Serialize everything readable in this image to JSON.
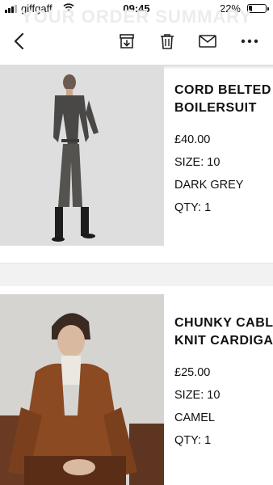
{
  "status_bar": {
    "carrier": "giffgaff",
    "time": "09:45",
    "battery_pct": "22%",
    "battery_level": 0.22
  },
  "header": {
    "ghost_title": "YOUR ORDER SUMMARY"
  },
  "toolbar": {
    "icons": [
      "back-chevron-icon",
      "archive-icon",
      "trash-icon",
      "mail-icon",
      "more-icon"
    ]
  },
  "products": [
    {
      "name_line1": "CORD BELTED",
      "name_line2": "BOILERSUIT",
      "price": "£40.00",
      "size": "SIZE: 10",
      "colour": "DARK GREY",
      "qty": "QTY: 1"
    },
    {
      "name_line1": "CHUNKY CABLE",
      "name_line2": "KNIT CARDIGAN",
      "price": "£25.00",
      "size": "SIZE: 10",
      "colour": "CAMEL",
      "qty": "QTY: 1"
    }
  ]
}
